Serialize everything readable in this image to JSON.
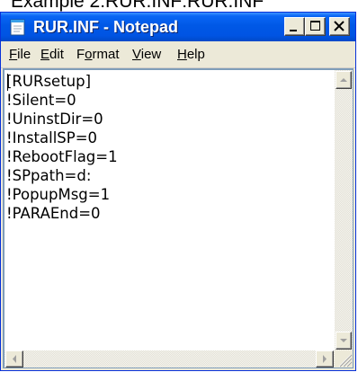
{
  "caption": "Example 2:RUR.INF:RUR.INF",
  "window": {
    "title": "RUR.INF - Notepad",
    "icon": "notepad-icon",
    "controls": [
      "minimize-icon",
      "maximize-icon",
      "close-icon"
    ]
  },
  "menu": {
    "file": {
      "mnemonic": "F",
      "rest": "ile"
    },
    "edit": {
      "mnemonic": "E",
      "rest": "dit"
    },
    "format": {
      "pre": "F",
      "mnemonic": "o",
      "rest": "rmat"
    },
    "view": {
      "mnemonic": "V",
      "rest": "iew"
    },
    "help": {
      "mnemonic": "H",
      "rest": "elp"
    }
  },
  "editor": {
    "content": "[RURsetup]\n!Silent=0\n!UninstDir=0\n!InstallSP=0\n!RebootFlag=1\n!SPpath=d:\n!PopupMsg=1\n!PARAEnd=0"
  },
  "colors": {
    "titlebar": "#0054e3",
    "window_face": "#ece9d8",
    "close_glyph": "#000000"
  }
}
